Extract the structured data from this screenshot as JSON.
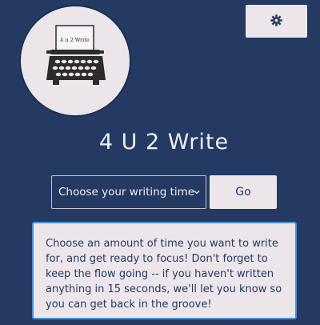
{
  "logo": {
    "paper_text": "4 u 2 Write"
  },
  "header": {
    "title": "4 U 2 Write"
  },
  "settings": {
    "icon": "gear-icon"
  },
  "timer": {
    "select_value": "Choose your writing time",
    "go_label": "Go"
  },
  "info": {
    "text": "Choose an amount of time you want to write for, and get ready to focus! Don't forget to keep the flow going -- if you haven't written anything in 15 seconds, we'll let you know so you can get back in the groove!"
  },
  "colors": {
    "background": "#243a63",
    "panel": "#ece6ea",
    "accent_border": "#4a8fd4"
  }
}
